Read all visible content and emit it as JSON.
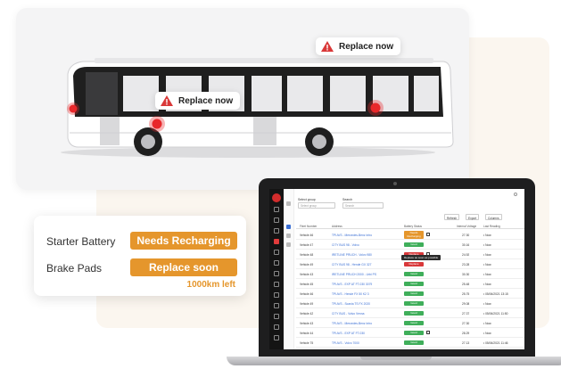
{
  "bus_scene": {
    "callout_top": "Replace now",
    "callout_mid": "Replace now",
    "colors": {
      "alert_red": "#e8282b",
      "warn_red": "#d93838",
      "bus_white": "#ffffff",
      "bus_dark": "#1f1f1f"
    }
  },
  "status_card": {
    "rows": [
      {
        "label": "Starter Battery",
        "status": "Needs Recharging"
      },
      {
        "label": "Brake Pads",
        "status": "Replace soon"
      }
    ],
    "note": "1000km left",
    "accent": "#e5962c"
  },
  "app": {
    "filters": {
      "group_label": "Select group",
      "group_placeholder": "Select group",
      "search_label": "Search",
      "search_placeholder": "Search"
    },
    "toolbar": {
      "refresh": "Refresh",
      "export": "Export",
      "columns": "Columns"
    },
    "columns": [
      "Fleet Number",
      "Address",
      "Battery Status",
      "Internal Voltage",
      "Last Reading"
    ],
    "tooltip": "Replace as soon as possible",
    "rows": [
      {
        "vehicle": "Vehicle 46",
        "address": "TPLN/S - Mercedes-Benz Intro",
        "status": "Needs Recharging",
        "status_kind": "recharge",
        "voltage": "27.30",
        "last": "• Now"
      },
      {
        "vehicle": "Vehicle 47",
        "address": "CITY BUS 98 - Volvo",
        "status": "Good",
        "status_kind": "good",
        "voltage": "30.16",
        "last": "• Now"
      },
      {
        "vehicle": "Vehicle 48",
        "address": "IRETLINE PRUCH - Volvo 980",
        "status": "Replace",
        "status_kind": "replace",
        "voltage": "24.92",
        "last": "• Now"
      },
      {
        "vehicle": "Vehicle 49",
        "address": "CITY BUS 98 - Hende GX 327",
        "status": "Replace",
        "status_kind": "replace",
        "voltage": "23.28",
        "last": "• Now"
      },
      {
        "vehicle": "Vehicle 43",
        "address": "IRETLINE PRUCH 2000 - Urbi PS",
        "status": "Good",
        "status_kind": "good",
        "voltage": "30.30",
        "last": "• Now"
      },
      {
        "vehicle": "Vehicle 45",
        "address": "TPLN/S - EXP AT FT-030 3079",
        "status": "Good",
        "status_kind": "good",
        "voltage": "25.48",
        "last": "• Now"
      },
      {
        "vehicle": "Vehicle 46",
        "address": "TPLN/S - Hende FX 50 K2 3",
        "status": "Good",
        "status_kind": "good",
        "voltage": "25.75",
        "last": "• 05/06/2021 13:15"
      },
      {
        "vehicle": "Vehicle 49",
        "address": "TPLN/S - Scania TS FX 2020",
        "status": "Good",
        "status_kind": "good",
        "voltage": "29.08",
        "last": "• Now"
      },
      {
        "vehicle": "Vehicle 42",
        "address": "CITY BUS - Volvo Venna",
        "status": "Good",
        "status_kind": "good",
        "voltage": "27.37",
        "last": "• 05/06/2021 11:50"
      },
      {
        "vehicle": "Vehicle 43",
        "address": "TPLN/S - Mercedes-Benz Intro",
        "status": "Good",
        "status_kind": "good",
        "voltage": "27.30",
        "last": "• Now"
      },
      {
        "vehicle": "Vehicle 44",
        "address": "TPLN/S - EXP AT FT-030",
        "status": "Good",
        "status_kind": "good",
        "voltage": "28.29",
        "last": "• Now"
      },
      {
        "vehicle": "Vehicle 75",
        "address": "TPLN/S - Volvo 7000",
        "status": "Good",
        "status_kind": "good",
        "voltage": "27.13",
        "last": "• 05/06/2021 11:46"
      }
    ]
  }
}
